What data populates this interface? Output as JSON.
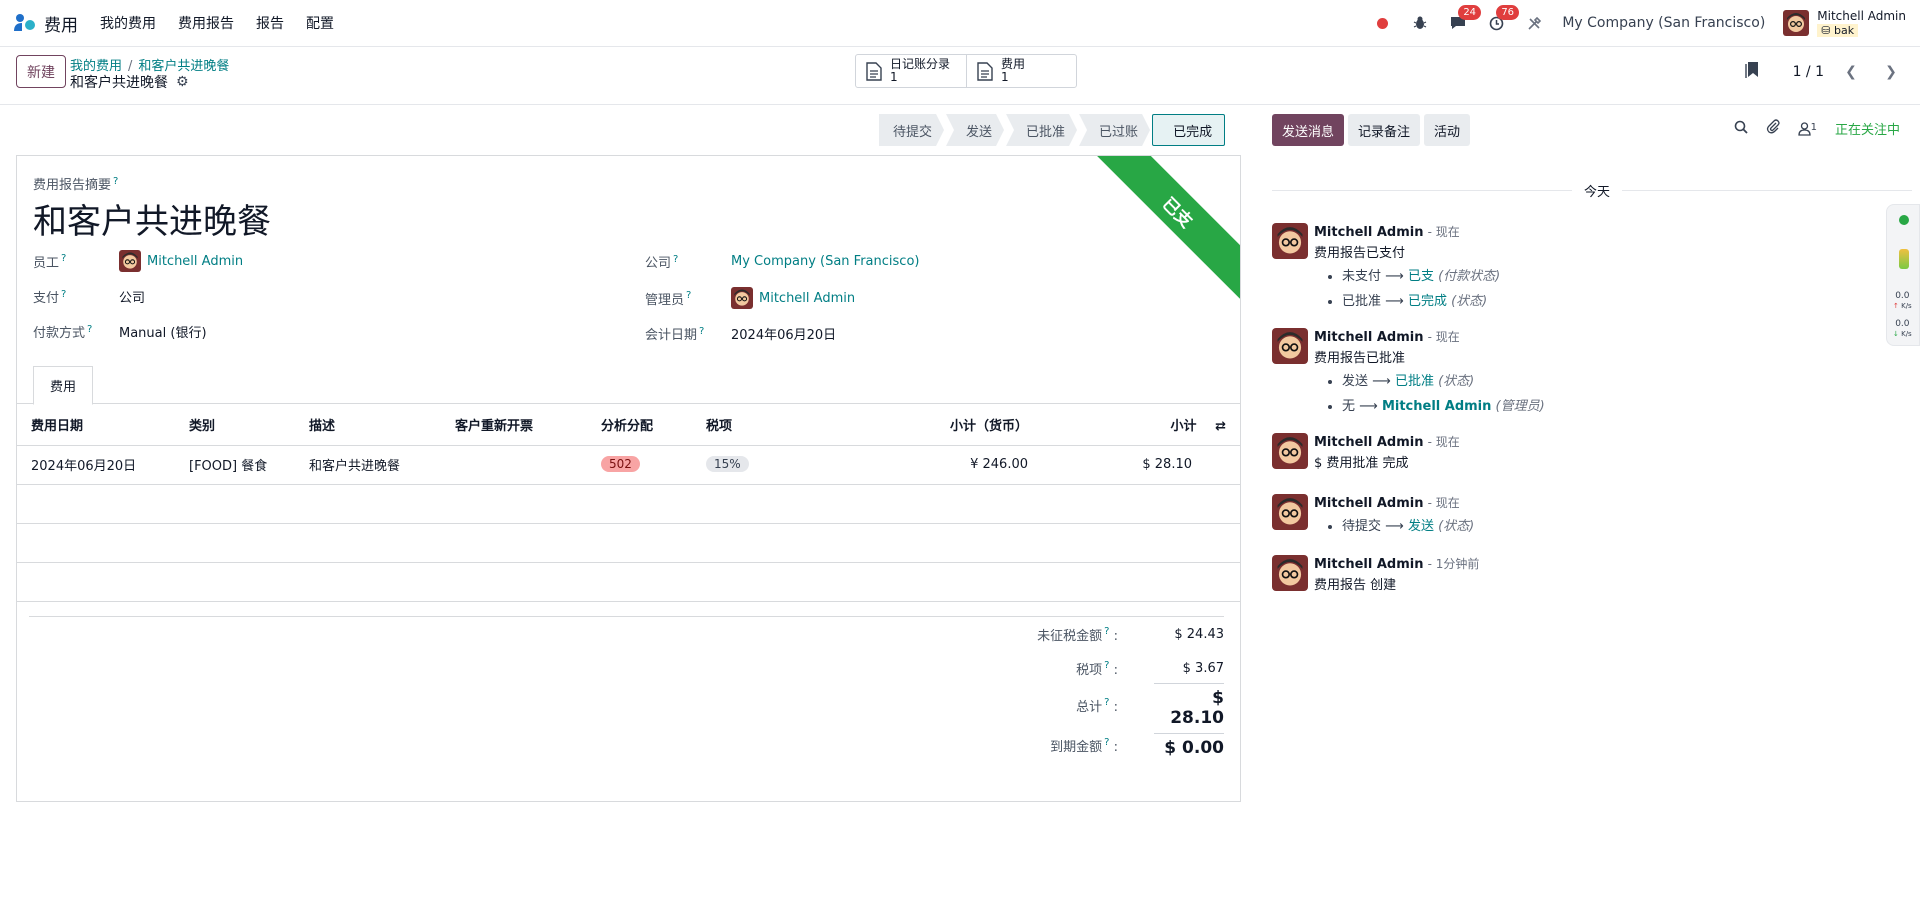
{
  "nav": {
    "app_name": "费用",
    "menu": [
      "我的费用",
      "费用报告",
      "报告",
      "配置"
    ],
    "messages_count": "24",
    "activities_count": "76",
    "company": "My Company (San Francisco)",
    "user_name": "Mitchell Admin",
    "db_name": "bak"
  },
  "control": {
    "new_label": "新建",
    "breadcrumb": [
      "我的费用",
      "和客户共进晚餐"
    ],
    "record_name": "和客户共进晚餐",
    "smart_buttons": [
      {
        "label": "日记账分录",
        "count": "1"
      },
      {
        "label": "费用",
        "count": "1"
      }
    ],
    "pager": "1 / 1"
  },
  "status": {
    "stages": [
      "待提交",
      "发送",
      "已批准",
      "已过账",
      "已完成"
    ],
    "active": "已完成"
  },
  "form": {
    "ribbon": "已支",
    "summary_label": "费用报告摘要",
    "summary_title": "和客户共进晚餐",
    "fields_left": [
      {
        "label": "员工",
        "value": "Mitchell Admin"
      },
      {
        "label": "支付",
        "value": "公司"
      },
      {
        "label": "付款方式",
        "value": "Manual (银行)"
      }
    ],
    "fields_right": [
      {
        "label": "公司",
        "value": "My Company (San Francisco)"
      },
      {
        "label": "管理员",
        "value": "Mitchell Admin"
      },
      {
        "label": "会计日期",
        "value": "2024年06月20日"
      }
    ],
    "tab": "费用",
    "columns": [
      "费用日期",
      "类别",
      "描述",
      "客户重新开票",
      "分析分配",
      "税项",
      "小计（货币）",
      "小计"
    ],
    "row": {
      "date": "2024年06月20日",
      "category": "[FOOD] 餐食",
      "description": "和客户共进晚餐",
      "reinvoice": "",
      "analytic": "502",
      "tax": "15%",
      "subtotal_currency": "¥ 246.00",
      "subtotal": "$ 28.10"
    },
    "totals": [
      {
        "label": "未征税金额",
        "value": "$ 24.43"
      },
      {
        "label": "税项",
        "value": "$ 3.67"
      },
      {
        "label": "总计",
        "value": "$ 28.10"
      },
      {
        "label": "到期金额",
        "value": "$ 0.00"
      }
    ]
  },
  "chatter": {
    "send_message": "发送消息",
    "log_note": "记录备注",
    "activity": "活动",
    "followers_count": "1",
    "following": "正在关注中",
    "day": "今天",
    "messages": [
      {
        "author": "Mitchell Admin",
        "time": "- 现在",
        "body": "费用报告已支付",
        "changes": [
          {
            "from": "未支付",
            "to": "已支",
            "field": "(付款状态)"
          },
          {
            "from": "已批准",
            "to": "已完成",
            "field": "(状态)"
          }
        ]
      },
      {
        "author": "Mitchell Admin",
        "time": "- 现在",
        "body": "费用报告已批准",
        "changes": [
          {
            "from": "发送",
            "to": "已批准",
            "field": "(状态)"
          },
          {
            "from": "无",
            "to": "Mitchell Admin",
            "field": "(管理员)"
          }
        ]
      },
      {
        "author": "Mitchell Admin",
        "time": "- 现在",
        "body": "$ 费用批准 完成"
      },
      {
        "author": "Mitchell Admin",
        "time": "- 现在",
        "body": "",
        "changes": [
          {
            "from": "待提交",
            "to": "发送",
            "field": "(状态)"
          }
        ]
      },
      {
        "author": "Mitchell Admin",
        "time": "- 1分钟前",
        "body": "费用报告 创建"
      }
    ]
  },
  "widget": {
    "up": "0.0",
    "down": "0.0",
    "unit": "K/s"
  },
  "colors": {
    "brand": "#71445f",
    "teal": "#017e84",
    "paid": "#28a745"
  }
}
